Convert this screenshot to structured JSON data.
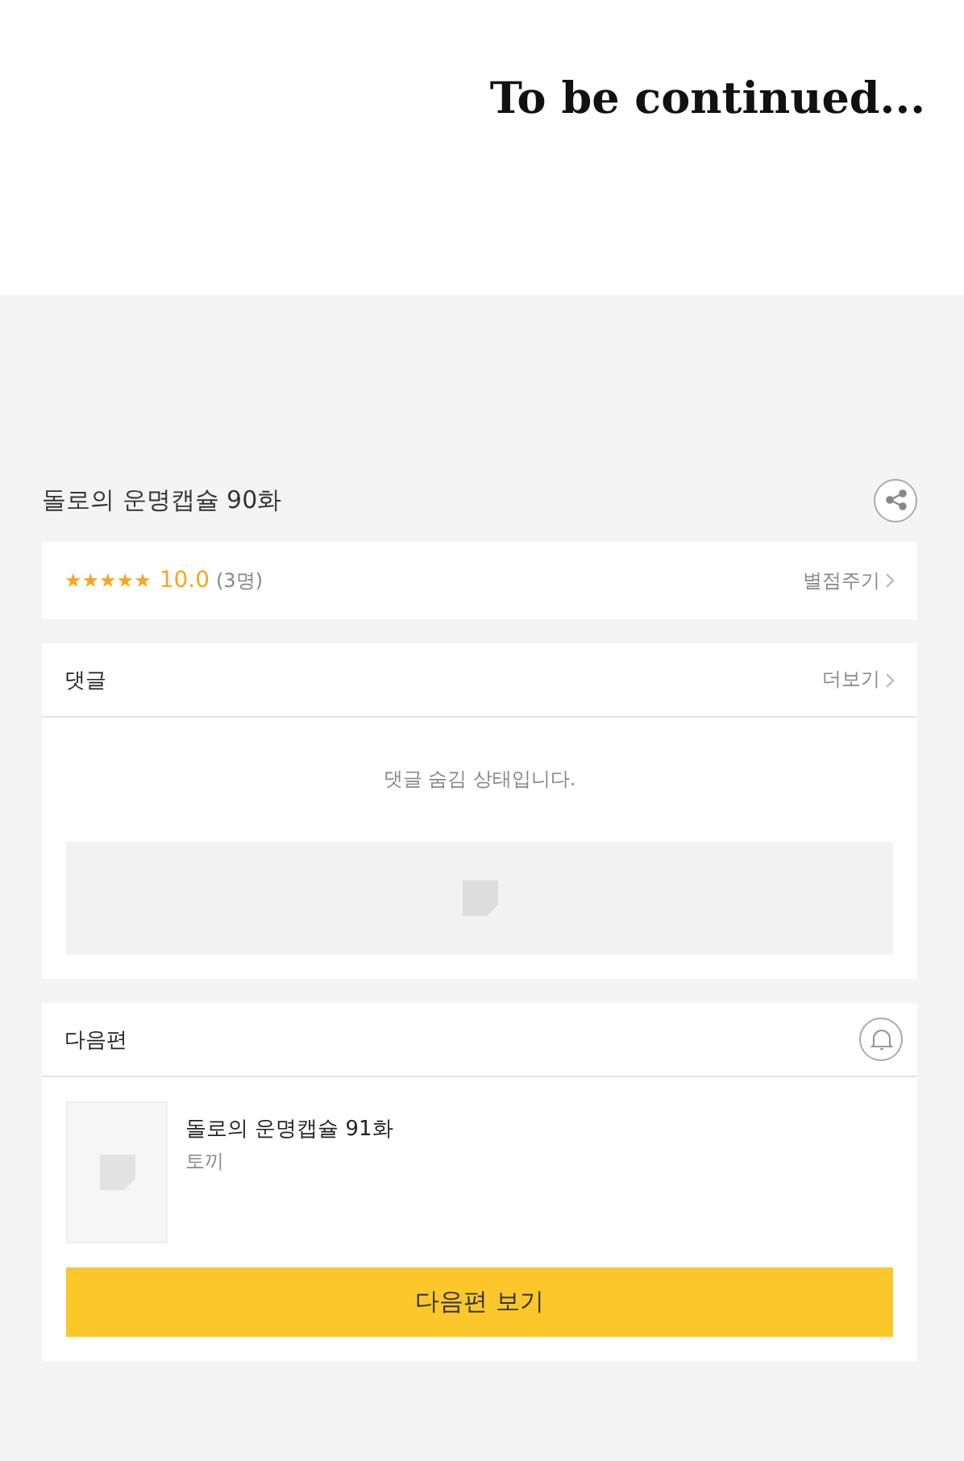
{
  "comic_panel": {
    "caption": "To be continued..."
  },
  "episode": {
    "title": "돌로의 운명캡슐 90화"
  },
  "rating": {
    "stars": 5,
    "score": "10.0",
    "count": "(3명)",
    "action": "별점주기"
  },
  "comments": {
    "heading": "댓글",
    "more": "더보기",
    "notice": "댓글 숨김 상태입니다."
  },
  "next_episode": {
    "heading": "다음편",
    "title": "돌로의 운명캡슐 91화",
    "author": "토끼",
    "button": "다음편 보기"
  }
}
